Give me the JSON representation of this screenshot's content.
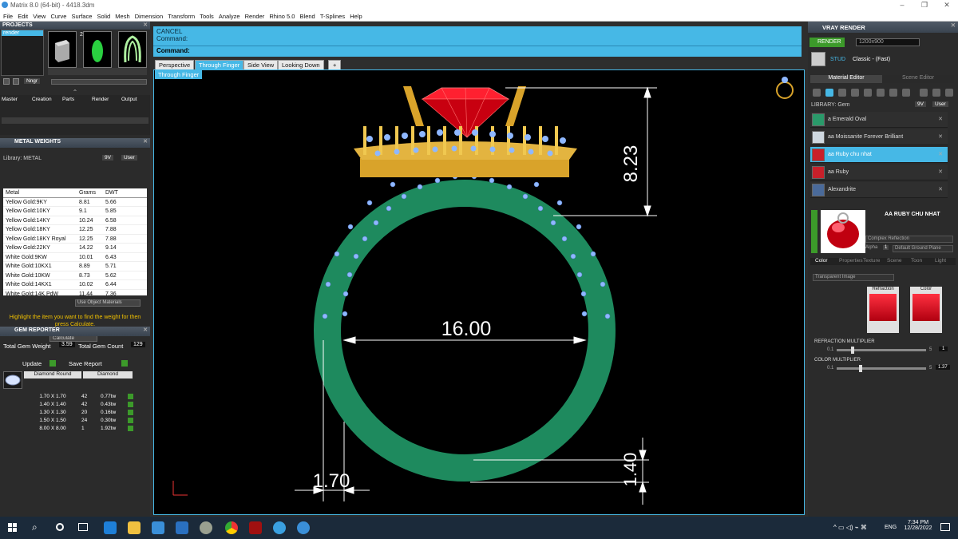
{
  "window": {
    "title": "Matrix 8.0 (64-bit) - 4418.3dm"
  },
  "menu": [
    "File",
    "Edit",
    "View",
    "Curve",
    "Surface",
    "Solid",
    "Mesh",
    "Dimension",
    "Transform",
    "Tools",
    "Analyze",
    "Render",
    "Rhino 5.0",
    "Blend",
    "T-Splines",
    "Help"
  ],
  "projects": {
    "title": "PROJECTS",
    "item": "render",
    "thumbs": [
      "1",
      "2",
      "3"
    ],
    "search_btn": "Nngr"
  },
  "panels": [
    "Master",
    "Creation",
    "Parts",
    "Render",
    "Output"
  ],
  "metal_weights": {
    "title": "METAL WEIGHTS",
    "library": "Library: METAL",
    "toggle_a": "9V",
    "toggle_b": "User",
    "headers": [
      "Metal",
      "Grams",
      "DWT"
    ],
    "rows": [
      [
        "Yellow Gold:9KY",
        "8.81",
        "5.66"
      ],
      [
        "Yellow Gold:10KY",
        "9.1",
        "5.85"
      ],
      [
        "Yellow Gold:14KY",
        "10.24",
        "6.58"
      ],
      [
        "Yellow Gold:18KY",
        "12.25",
        "7.88"
      ],
      [
        "Yellow Gold:18KY Royal",
        "12.25",
        "7.88"
      ],
      [
        "Yellow Gold:22KY",
        "14.22",
        "9.14"
      ],
      [
        "White Gold:9KW",
        "10.01",
        "6.43"
      ],
      [
        "White Gold:10KX1",
        "8.89",
        "5.71"
      ],
      [
        "White Gold:10KW",
        "8.73",
        "5.62"
      ],
      [
        "White Gold:14KX1",
        "10.02",
        "6.44"
      ],
      [
        "White Gold:14K PdW",
        "11.44",
        "7.36"
      ]
    ],
    "use_object": "Use Object Materials",
    "hint": "Highlight the item you want to find the weight for then press Calculate.",
    "calculate": "Calculate"
  },
  "gem_reporter": {
    "title": "GEM REPORTER",
    "total_weight_label": "Total Gem Weight",
    "total_weight": "3.59",
    "total_count_label": "Total Gem Count",
    "total_count": "129",
    "update": "Update",
    "save_report": "Save Report",
    "headers": [
      "Diamond Round",
      "Diamond"
    ],
    "rows": [
      [
        "1.70 X 1.70",
        "42",
        "0.77tw"
      ],
      [
        "1.40 X 1.40",
        "42",
        "0.43tw"
      ],
      [
        "1.30 X 1.30",
        "20",
        "0.16tw"
      ],
      [
        "1.50 X 1.50",
        "24",
        "0.30tw"
      ],
      [
        "8.00 X 8.00",
        "1",
        "1.92tw"
      ]
    ]
  },
  "command": {
    "line1": "CANCEL",
    "line2": "Command:",
    "prompt": "Command:"
  },
  "tabs": [
    "Perspective",
    "Through Finger",
    "Side View",
    "Looking Down",
    "+"
  ],
  "active_tab": "Through Finger",
  "viewport_label": "Through Finger",
  "dimensions": {
    "height": "8.23",
    "diameter": "16.00",
    "band_width": "1.70",
    "band_thickness": "1.40"
  },
  "vray": {
    "title": "VRAY RENDER",
    "render_btn": "RENDER",
    "resolution": "1200x900",
    "preset_prefix": "STUD",
    "preset": "Classic - (Fast)",
    "tabs": [
      "Material Editor",
      "Scene Editor"
    ],
    "library": "LIBRARY: Gem",
    "toggle_a": "9V",
    "toggle_b": "User",
    "materials": [
      {
        "name": "a Emerald Oval",
        "color": "#2a9a6a"
      },
      {
        "name": "aa Moissanite Forever Brilliant",
        "color": "#cfd8e0"
      },
      {
        "name": "aa Ruby chu nhat",
        "color": "#c8202a"
      },
      {
        "name": "aa Ruby",
        "color": "#c8202a"
      },
      {
        "name": "Alexandrite",
        "color": "#4a6a9a"
      }
    ],
    "selected_material": "AA RUBY CHU NHAT",
    "refraction_type": "Complex Reflection",
    "alpha": "Alpha",
    "alpha_val": "1",
    "ground": "Default Ground Plane",
    "sub_tabs": [
      "Color",
      "Properties",
      "Texture",
      "Scene",
      "Toon",
      "Light"
    ],
    "transparent": "Transparent Image",
    "swatch_labels": [
      "Refraction",
      "Color"
    ],
    "refraction_mult_label": "REFRACTION MULTIPLIER",
    "refraction_min": "0.1",
    "refraction_max": "5",
    "refraction_val": "1",
    "color_mult_label": "COLOR MULTIPLIER",
    "color_min": "0.1",
    "color_max": "5",
    "color_val": "1.37"
  },
  "taskbar": {
    "lang": "ENG",
    "time": "7:34 PM",
    "date": "12/28/2022"
  },
  "colors": {
    "accent": "#46b8e6",
    "band": "#1e8a5e",
    "gold": "#d9a32a",
    "ruby": "#e0101a",
    "diamond": "#8fb8ff"
  }
}
